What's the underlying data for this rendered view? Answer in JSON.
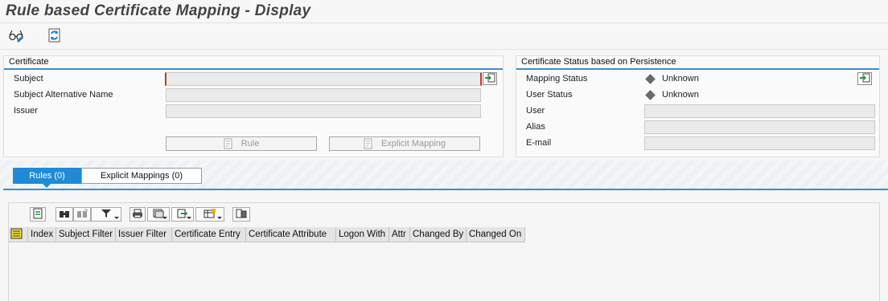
{
  "window": {
    "title": "Rule based Certificate Mapping - Display"
  },
  "toolbar": {
    "items": [
      {
        "icon": "display-change-glasses-icon"
      },
      {
        "icon": "refresh-icon"
      }
    ]
  },
  "certificate_group": {
    "title": "Certificate",
    "fields": [
      {
        "label": "Subject",
        "value": ""
      },
      {
        "label": "Subject Alternative Name",
        "value": ""
      },
      {
        "label": "Issuer",
        "value": ""
      }
    ],
    "rule_button": "Rule",
    "explicit_mapping_button": "Explicit Mapping"
  },
  "status_group": {
    "title": "Certificate Status based on Persistence",
    "mapping_status_label": "Mapping Status",
    "mapping_status_value": "Unknown",
    "user_status_label": "User Status",
    "user_status_value": "Unknown",
    "fields": [
      {
        "label": "User",
        "value": ""
      },
      {
        "label": "Alias",
        "value": ""
      },
      {
        "label": "E-mail",
        "value": ""
      }
    ]
  },
  "tabs": [
    {
      "label": "Rules (0)",
      "active": true
    },
    {
      "label": "Explicit Mappings (0)",
      "active": false
    }
  ],
  "grid": {
    "toolbar_icons": [
      "details-icon",
      "find-icon",
      "find-next-icon",
      "filter-icon",
      "print-icon",
      "views-icon",
      "export-icon",
      "layout-icon",
      "graphic-icon"
    ],
    "columns": [
      "Index",
      "Subject Filter",
      "Issuer Filter",
      "Certificate Entry",
      "Certificate Attribute",
      "Logon With",
      "Attr",
      "Changed By",
      "Changed On"
    ],
    "rows": []
  },
  "colors": {
    "accent": "#1f8bd6",
    "group_line": "#3c8ec8",
    "focus": "#c0392b"
  }
}
